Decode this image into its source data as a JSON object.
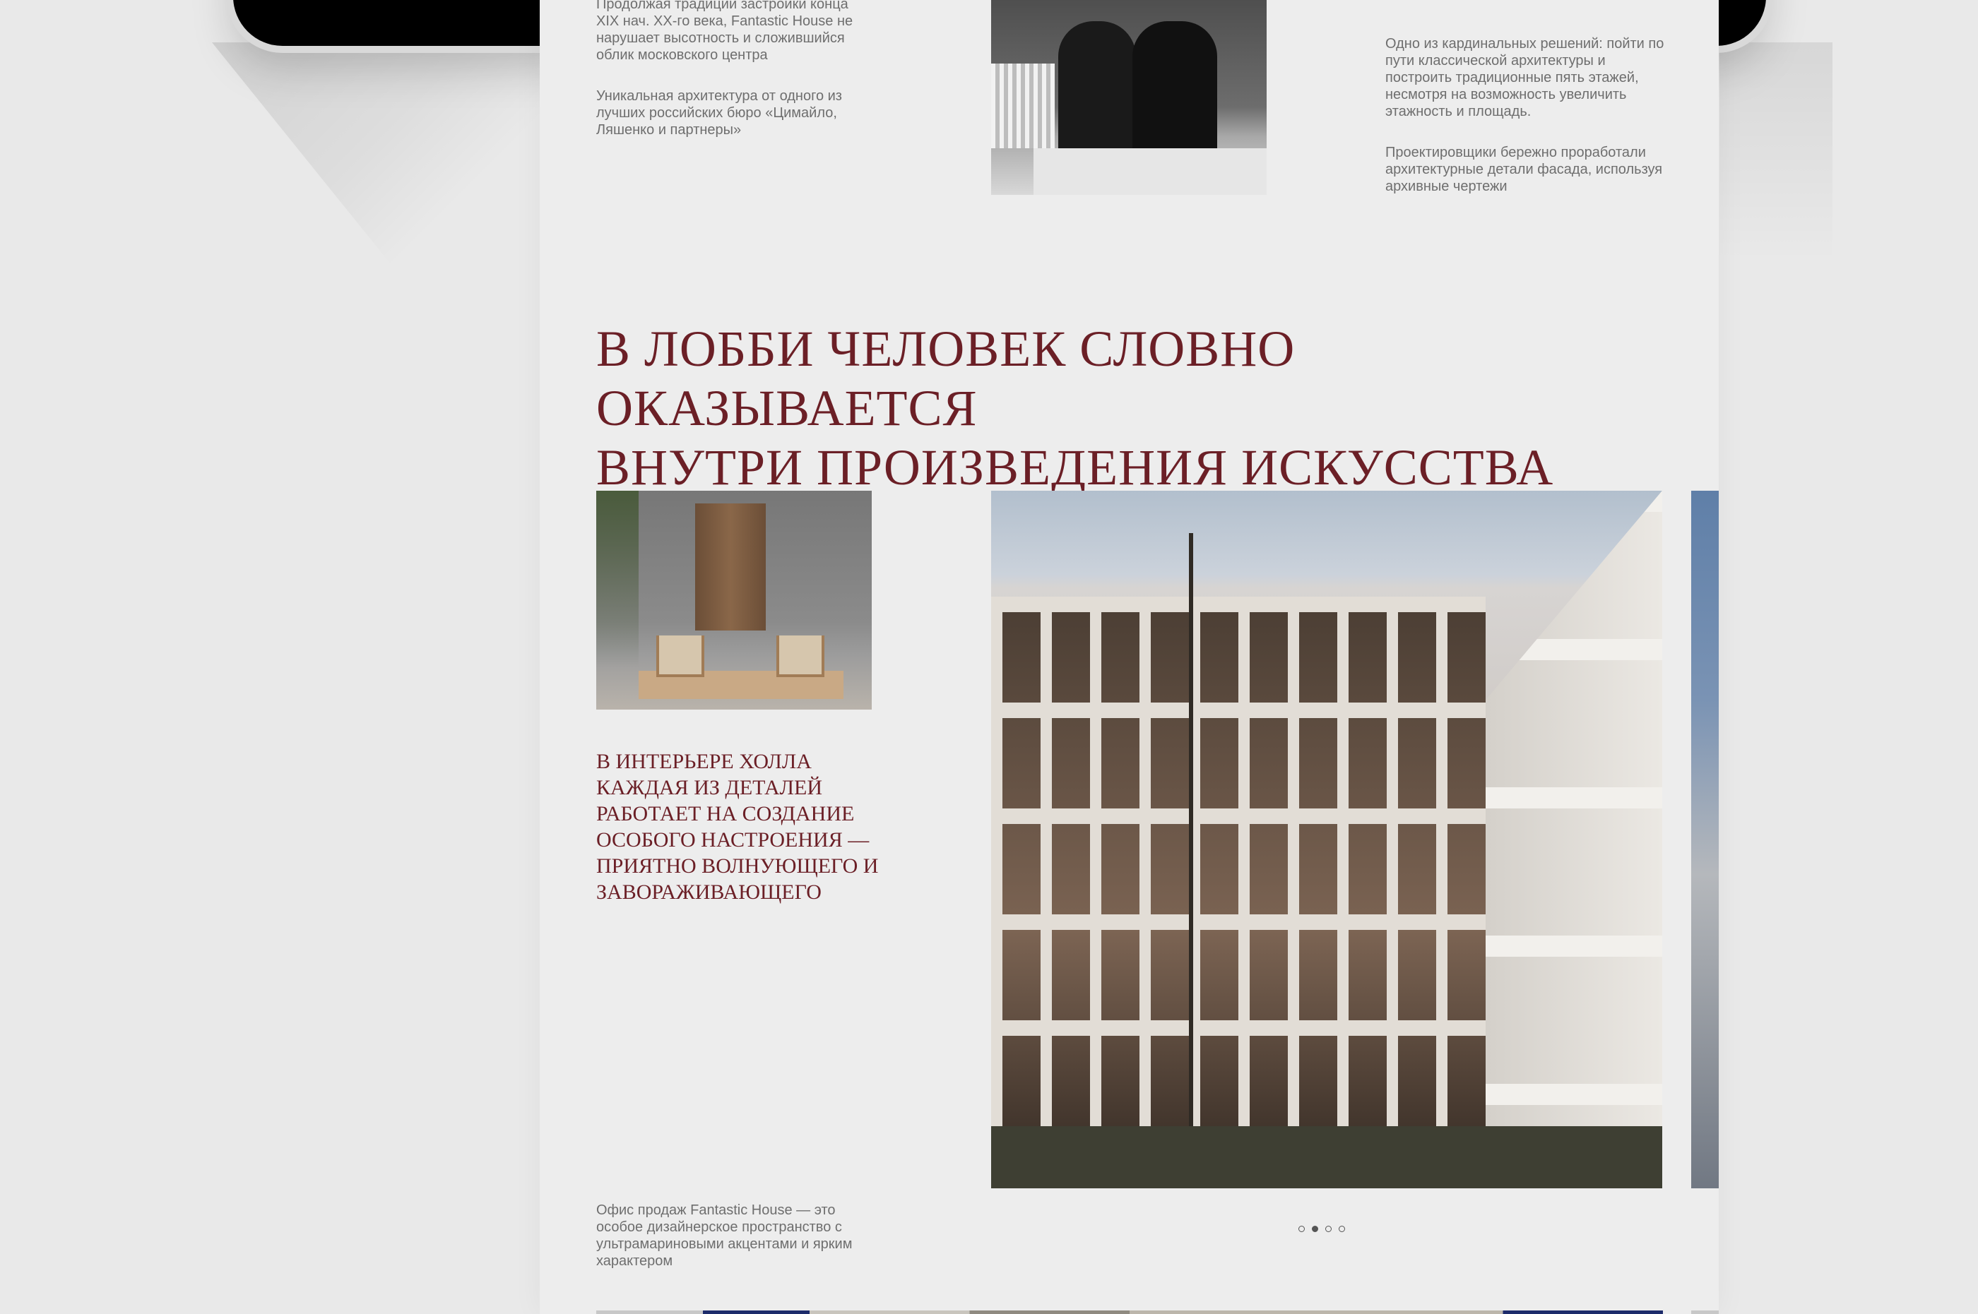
{
  "intro": {
    "left_paragraph_1": "Продолжая традиции застройки конца XIX  нач. XX-го века, Fantastic House не нарушает высотность и сложившийся облик московского центра",
    "left_paragraph_2": "Уникальная архитектура от одного из лучших российских бюро «Цимайло, Ляшенко и партнеры»",
    "right_paragraph_1": "Одно из кардинальных решений: пойти по пути классической архитектуры и построить традиционные пять этажей, несмотря на возможность увеличить этажность и площадь.",
    "right_paragraph_2": "Проектировщики бережно проработали архитектурные детали фасада, используя архивные чертежи"
  },
  "lobby_section": {
    "heading_line_1": "В лобби человек словно оказывается",
    "heading_line_2": "внутри произведения искусства",
    "subheading": "В интерьере холла каждая из деталей работает на создание особого настроения — приятно волнующего и завораживающего",
    "caption": "Офис продаж Fantastic House — это особое дизайнерское пространство с ультрамариновыми акцентами и ярким характером"
  },
  "slider": {
    "total_slides": 4,
    "active_index": 1
  },
  "colors": {
    "accent_text": "#6b1f26",
    "body_text": "#6e6e6e",
    "background": "#ededed"
  }
}
